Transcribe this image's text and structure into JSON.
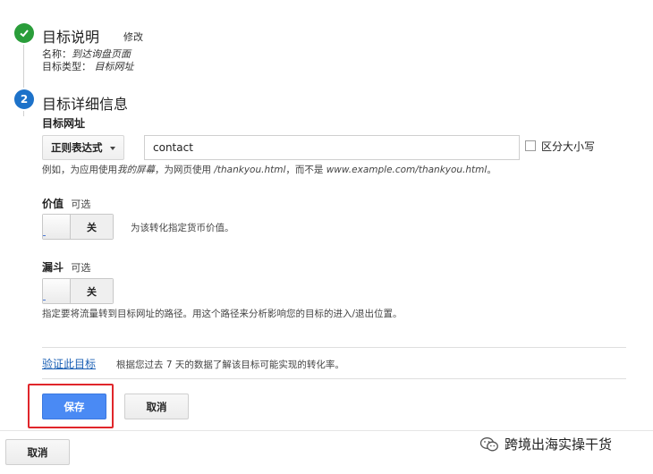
{
  "step1": {
    "title": "目标说明",
    "edit_label": "修改",
    "name_line": "名称：",
    "name_value": "到达询盘页面",
    "type_line": "目标类型：",
    "type_value": "目标网址"
  },
  "step2": {
    "number": "2",
    "title": "目标详细信息",
    "destination_label": "目标网址",
    "match_type": "正则表达式",
    "destination_value": "contact",
    "case_sensitive_label": "区分大小写",
    "help_prefix": "例如，为应用使用",
    "help_app": "我的屏幕",
    "help_mid": "，为网页使用",
    "help_page": "/thankyou.html",
    "help_mid2": "，而不是",
    "help_url": "www.example.com/thankyou.html",
    "help_end": "。"
  },
  "value": {
    "label": "价值",
    "optional": "可选",
    "toggle_state": "关",
    "description": "为该转化指定货币价值。"
  },
  "funnel": {
    "label": "漏斗",
    "optional": "可选",
    "toggle_state": "关",
    "description": "指定要将流量转到目标网址的路径。用这个路径来分析影响您的目标的进入/退出位置。"
  },
  "verify": {
    "link": "验证此目标",
    "description": "根据您过去 7 天的数据了解该目标可能实现的转化率。"
  },
  "actions": {
    "save": "保存",
    "cancel": "取消",
    "outer_cancel": "取消"
  },
  "watermark": {
    "text": "跨境出海实操干货",
    "icon": "wechat-icon"
  },
  "colors": {
    "done": "#2a9d3a",
    "active": "#1d72c9",
    "primary": "#4a8af4",
    "highlight": "#e0262b"
  }
}
